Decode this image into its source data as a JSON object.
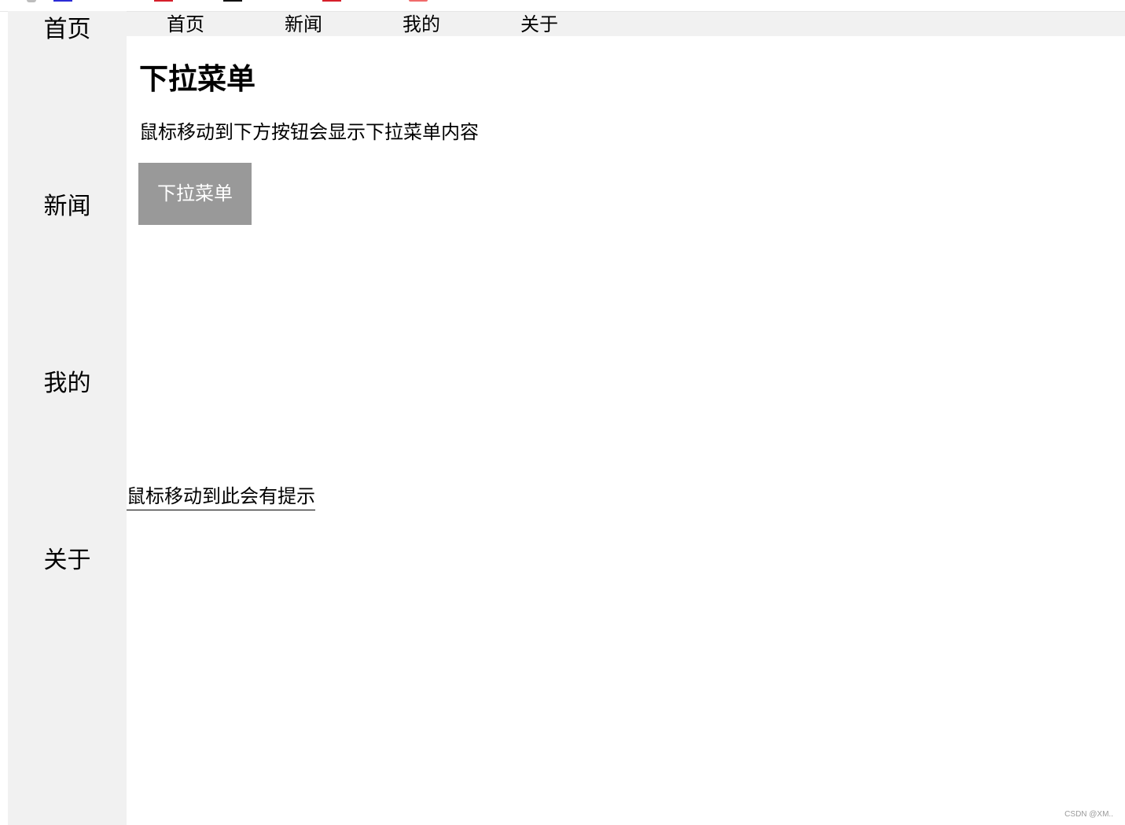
{
  "sidebar": {
    "items": [
      {
        "label": "首页"
      },
      {
        "label": "新闻"
      },
      {
        "label": "我的"
      },
      {
        "label": "关于"
      }
    ]
  },
  "topnav": {
    "items": [
      {
        "label": "首页"
      },
      {
        "label": "新闻"
      },
      {
        "label": "我的"
      },
      {
        "label": "关于"
      }
    ]
  },
  "main": {
    "title": "下拉菜单",
    "description": "鼠标移动到下方按钮会显示下拉菜单内容",
    "dropdown_button_label": "下拉菜单",
    "tooltip_text": "鼠标移动到此会有提示"
  },
  "watermark": "CSDN @XM..",
  "colors": {
    "sidebar_bg": "#f1f1f1",
    "topnav_bg": "#f1f1f1",
    "button_bg": "#999999",
    "button_text": "#ffffff"
  }
}
